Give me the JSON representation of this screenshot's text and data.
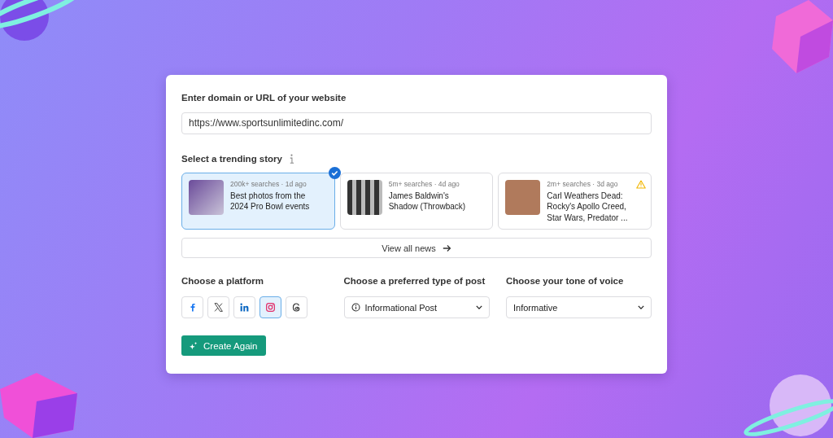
{
  "url_section": {
    "label": "Enter domain or URL of your website",
    "value": "https://www.sportsunlimitedinc.com/"
  },
  "trending": {
    "label": "Select a trending story",
    "stories": [
      {
        "meta": "200k+ searches · 1d ago",
        "title": "Best photos from the 2024 Pro Bowl events",
        "selected": true,
        "warning": false
      },
      {
        "meta": "5m+ searches · 4d ago",
        "title": "James Baldwin's Shadow (Throwback)",
        "selected": false,
        "warning": false
      },
      {
        "meta": "2m+ searches · 3d ago",
        "title": "Carl Weathers Dead: Rocky's Apollo Creed, Star Wars, Predator ...",
        "selected": false,
        "warning": true
      }
    ],
    "view_all": "View all news"
  },
  "platform": {
    "label": "Choose a platform",
    "items": [
      {
        "kind": "facebook",
        "selected": false
      },
      {
        "kind": "x",
        "selected": false
      },
      {
        "kind": "linkedin",
        "selected": false
      },
      {
        "kind": "instagram",
        "selected": true
      },
      {
        "kind": "threads",
        "selected": false
      }
    ]
  },
  "post_type": {
    "label": "Choose a preferred type of post",
    "value": "Informational Post"
  },
  "tone": {
    "label": "Choose your tone of voice",
    "value": "Informative"
  },
  "create_button": "Create Again"
}
